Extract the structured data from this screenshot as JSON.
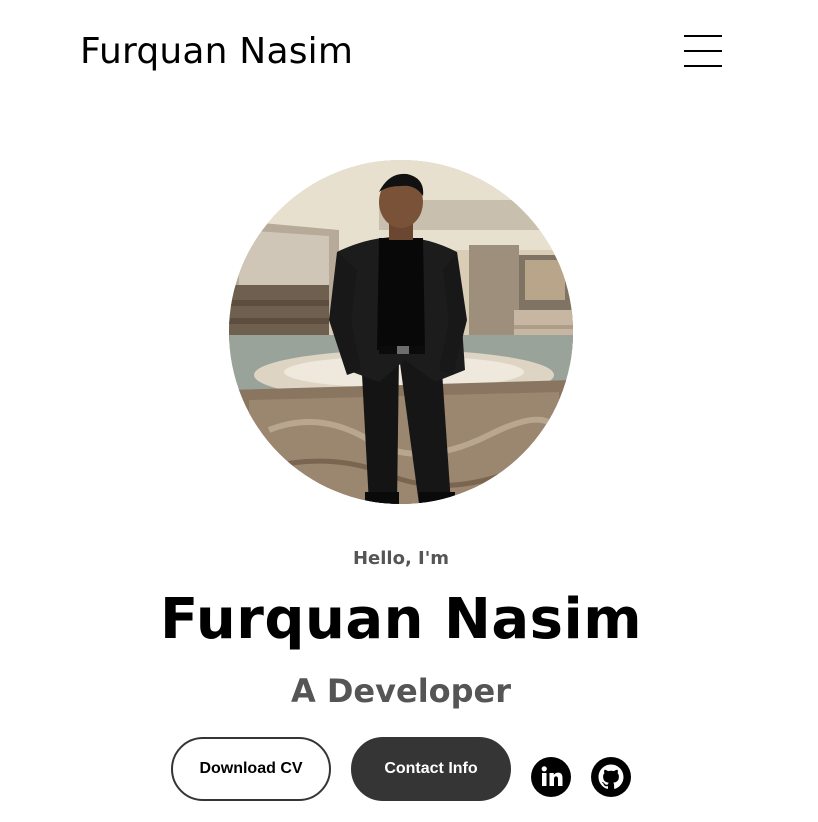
{
  "header": {
    "logo_text": "Furquan Nasim",
    "menu_icon": "hamburger-menu-icon"
  },
  "profile": {
    "image_alt": "Profile picture"
  },
  "intro": {
    "greeting": "Hello, I'm",
    "name": "Furquan Nasim",
    "role": "A Developer"
  },
  "buttons": {
    "download_cv": "Download CV",
    "contact_info": "Contact Info"
  },
  "socials": [
    {
      "icon": "linkedin-icon"
    },
    {
      "icon": "github-icon"
    }
  ],
  "colors": {
    "text_primary": "#000000",
    "text_secondary": "#555555",
    "button_dark": "#353535",
    "background": "#ffffff"
  }
}
